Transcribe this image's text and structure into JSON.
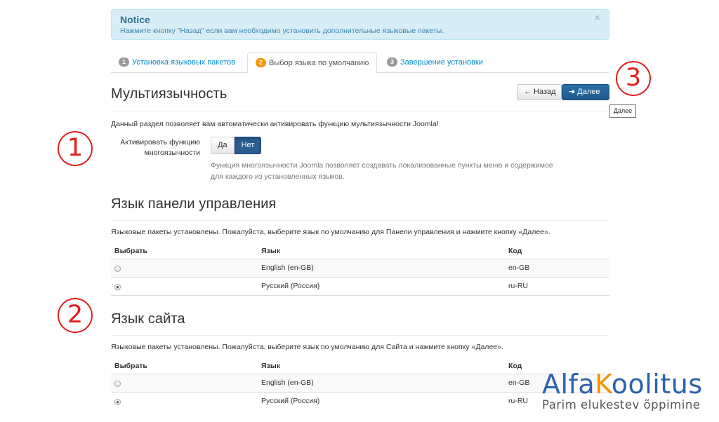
{
  "notice": {
    "title": "Notice",
    "text": "Нажмите кнопку \"Назад\" если вам необходимо установить дополнительные языковые пакеты.",
    "close": "×"
  },
  "tabs": [
    {
      "num": "1",
      "label": "Установка языковых пакетов",
      "active": false
    },
    {
      "num": "2",
      "label": "Выбор языка по умолчанию",
      "active": true
    },
    {
      "num": "3",
      "label": "Завершение установки",
      "active": false
    }
  ],
  "multilang": {
    "title": "Мультиязычность",
    "back_label": "← Назад",
    "next_label": "➜ Далее",
    "tooltip": "Далее",
    "intro": "Данный раздел позволяет вам автоматически активировать функцию мультиязычности Joomla!",
    "field_label_1": "Активировать функцию",
    "field_label_2": "многоязычности",
    "yes": "Да",
    "no": "Нет",
    "selected": "Нет",
    "help_1": "Функция многоязычности Joomla позволяет создавать локализованные пункты меню и содержимое",
    "help_2": "для каждого из установленных языков."
  },
  "admin_lang": {
    "title": "Язык панели управления",
    "intro": "Языковые пакеты установлены. Пожалуйста, выберите язык по умолчанию для Панели управления и нажмите кнопку «Далее».",
    "columns": [
      "Выбрать",
      "Язык",
      "Код"
    ],
    "rows": [
      {
        "language": "English (en-GB)",
        "code": "en-GB",
        "selected": false
      },
      {
        "language": "Русский (Россия)",
        "code": "ru-RU",
        "selected": true
      }
    ]
  },
  "site_lang": {
    "title": "Язык сайта",
    "intro": "Языковые пакеты установлены. Пожалуйста, выберите язык по умолчанию для Сайта и нажмите кнопку «Далее».",
    "columns": [
      "Выбрать",
      "Язык",
      "Код"
    ],
    "rows": [
      {
        "language": "English (en-GB)",
        "code": "en-GB",
        "selected": false
      },
      {
        "language": "Русский (Россия)",
        "code": "ru-RU",
        "selected": true
      }
    ]
  },
  "annotations": {
    "one": "1",
    "two": "2",
    "three": "3",
    "color": "#e31c1c"
  },
  "logo": {
    "part1": "Alfa",
    "part2": "K",
    "part3": "oolitus",
    "tagline": "Parim elukestev õppimine"
  }
}
